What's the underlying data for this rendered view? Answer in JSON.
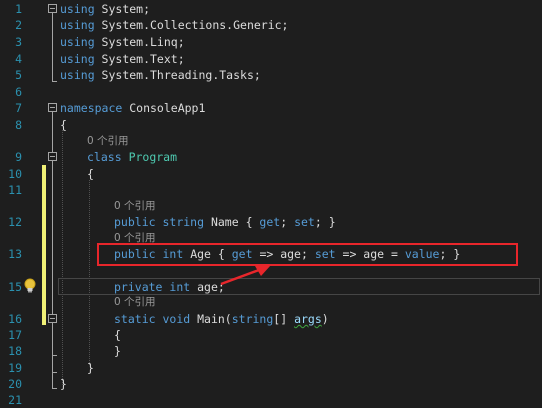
{
  "editor": {
    "line_numbers": [
      "1",
      "2",
      "3",
      "4",
      "5",
      "6",
      "7",
      "8",
      "9",
      "10",
      "11",
      "12",
      "13",
      "15",
      "16",
      "17",
      "18",
      "19",
      "20",
      "21"
    ],
    "lines": {
      "l1": {
        "kw": "using",
        "rest": " System;"
      },
      "l2": {
        "kw": "using",
        "rest": " System.Collections.Generic;"
      },
      "l3": {
        "kw": "using",
        "rest": " System.Linq;"
      },
      "l4": {
        "kw": "using",
        "rest": " System.Text;"
      },
      "l5": {
        "kw": "using",
        "rest": " System.Threading.Tasks;"
      },
      "l7": {
        "kw": "namespace",
        "rest": " ConsoleApp1"
      },
      "l8": {
        "text": "{"
      },
      "l9": {
        "kw": "class",
        "type": "Program"
      },
      "l10": {
        "text": "{"
      },
      "l12": {
        "kw1": "public",
        "kw2": "string",
        "name": " Name { ",
        "get": "get",
        "sep": "; ",
        "set": "set",
        "end": "; }"
      },
      "l13": {
        "kw1": "public",
        "kw2": "int",
        "name": " Age { ",
        "get": "get",
        "arrow1": " => age; ",
        "set": "set",
        "arrow2": " => age = ",
        "value": "value",
        "end": "; }"
      },
      "l15": {
        "kw1": "private",
        "kw2": "int",
        "name": " age;"
      },
      "l16": {
        "kw1": "static",
        "kw2": "void",
        "name": " Main(",
        "ptype": "string",
        "brackets": "[] ",
        "param": "args",
        "end": ")"
      },
      "l17": {
        "text": "{"
      },
      "l18": {
        "text": "}"
      },
      "l19": {
        "text": "}"
      },
      "l20": {
        "text": "}"
      }
    },
    "codelens": {
      "class": "0 个引用",
      "name_prop": "0 个引用",
      "age_prop": "0 个引用",
      "main": "0 个引用"
    },
    "colors": {
      "background": "#1e1e1e",
      "keyword": "#569cd6",
      "type": "#4ec9b0",
      "line_number": "#2b91af",
      "change_bar": "#f0f076",
      "callout": "#e8262b"
    },
    "icons": [
      "lightbulb-icon",
      "callout-arrow"
    ]
  }
}
